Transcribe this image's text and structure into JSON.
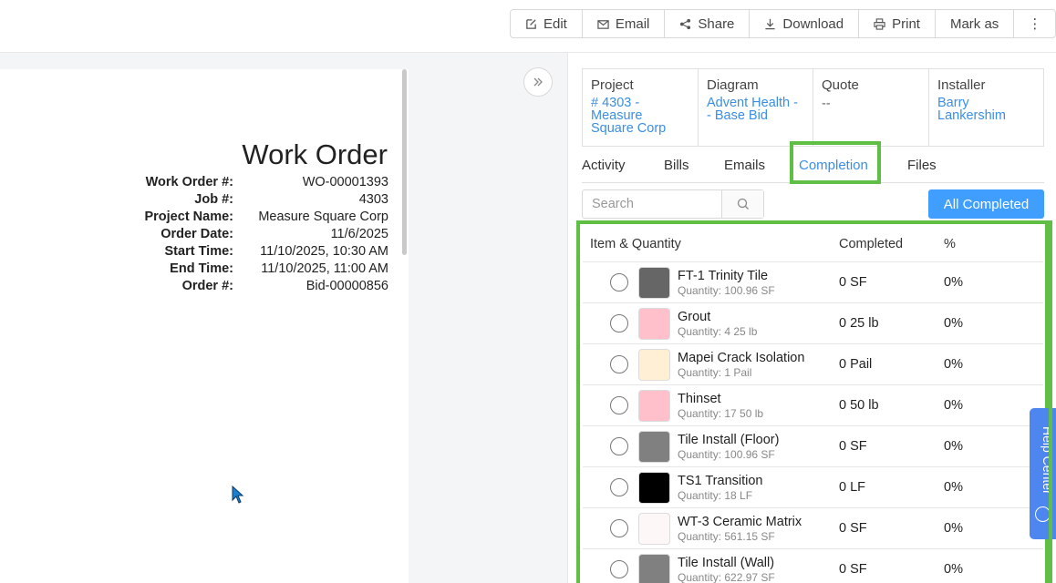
{
  "toolbar": {
    "buttons": [
      {
        "label": "Edit",
        "icon": "edit-icon"
      },
      {
        "label": "Email",
        "icon": "mail-icon"
      },
      {
        "label": "Share",
        "icon": "share-icon"
      },
      {
        "label": "Download",
        "icon": "download-icon"
      },
      {
        "label": "Print",
        "icon": "print-icon"
      },
      {
        "label": "Mark as",
        "icon": ""
      },
      {
        "label": "⋮",
        "icon": "more-icon"
      }
    ]
  },
  "work_order": {
    "title": "Work Order",
    "fields": [
      {
        "label": "Work Order #:",
        "value": "WO-00001393"
      },
      {
        "label": "Job #:",
        "value": "4303"
      },
      {
        "label": "Project Name:",
        "value": "Measure Square Corp"
      },
      {
        "label": "Order Date:",
        "value": "11/6/2025"
      },
      {
        "label": "Start Time:",
        "value": "11/10/2025, 10:30 AM"
      },
      {
        "label": "End Time:",
        "value": "11/10/2025, 11:00 AM"
      },
      {
        "label": "Order #:",
        "value": "Bid-00000856"
      }
    ]
  },
  "info": {
    "project": {
      "label": "Project",
      "value": [
        "# 4303 -",
        "Measure",
        "Square Corp"
      ]
    },
    "diagram": {
      "label": "Diagram",
      "value": [
        "Advent Health -",
        "- Base Bid"
      ]
    },
    "quote": {
      "label": "Quote",
      "value": "--"
    },
    "installer": {
      "label": "Installer",
      "value": [
        "Barry",
        "Lankershim"
      ]
    }
  },
  "tabs": [
    "Activity",
    "Bills",
    "Emails",
    "Completion",
    "Files"
  ],
  "active_tab": "Completion",
  "search": {
    "placeholder": "Search"
  },
  "all_completed_label": "All Completed",
  "table": {
    "headers": {
      "item": "Item & Quantity",
      "completed": "Completed",
      "percent": "%"
    },
    "rows": [
      {
        "name": "FT-1 Trinity Tile",
        "qty": "Quantity: 100.96 SF",
        "completed": "0 SF",
        "percent": "0%",
        "color": "#666666"
      },
      {
        "name": "Grout",
        "qty": "Quantity: 4 25 lb",
        "completed": "0 25 lb",
        "percent": "0%",
        "color": "#ffc0cb"
      },
      {
        "name": "Mapei Crack Isolation",
        "qty": "Quantity: 1 Pail",
        "completed": "0 Pail",
        "percent": "0%",
        "color": "#ffefd5"
      },
      {
        "name": "Thinset",
        "qty": "Quantity: 17 50 lb",
        "completed": "0 50 lb",
        "percent": "0%",
        "color": "#ffc0cb"
      },
      {
        "name": "Tile Install (Floor)",
        "qty": "Quantity: 100.96 SF",
        "completed": "0 SF",
        "percent": "0%",
        "color": "#808080"
      },
      {
        "name": "TS1 Transition",
        "qty": "Quantity: 18 LF",
        "completed": "0 LF",
        "percent": "0%",
        "color": "#000000"
      },
      {
        "name": "WT-3 Ceramic Matrix",
        "qty": "Quantity: 561.15 SF",
        "completed": "0 SF",
        "percent": "0%",
        "color": "#fdf7f7"
      },
      {
        "name": "Tile Install (Wall)",
        "qty": "Quantity: 622.97 SF",
        "completed": "0 SF",
        "percent": "0%",
        "color": "#808080"
      }
    ]
  },
  "help_center_label": "Help Center",
  "colors": {
    "accent": "#409eff",
    "link": "#3a8ee6",
    "highlight": "#5fbf45",
    "help": "#4e86f0"
  }
}
